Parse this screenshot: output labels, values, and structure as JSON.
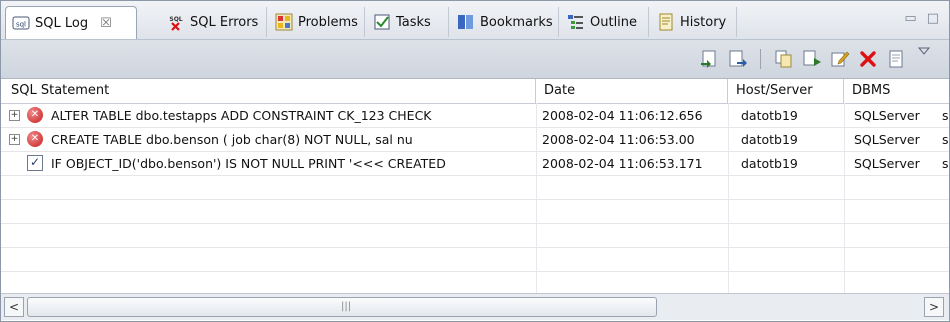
{
  "tabs": [
    {
      "label": "SQL Log",
      "icon": "sql-log-icon",
      "closeable": true
    },
    {
      "label": "SQL Errors",
      "icon": "sql-errors-icon"
    },
    {
      "label": "Problems",
      "icon": "problems-icon"
    },
    {
      "label": "Tasks",
      "icon": "tasks-icon"
    },
    {
      "label": "Bookmarks",
      "icon": "bookmarks-icon"
    },
    {
      "label": "Outline",
      "icon": "outline-icon"
    },
    {
      "label": "History",
      "icon": "history-icon"
    }
  ],
  "tab_close_glyph": "☒",
  "view_controls": {
    "minimize": "▭",
    "maximize": "□"
  },
  "columns": [
    "SQL Statement",
    "Date",
    "Host/Server",
    "DBMS"
  ],
  "rows": [
    {
      "status": "error",
      "expand": "+",
      "statement": "ALTER TABLE dbo.testapps    ADD CONSTRAINT CK_123    CHECK",
      "date": "2008-02-04 11:06:12.656",
      "host": "datotb19",
      "dbms": "SQLServer",
      "extra": "s"
    },
    {
      "status": "error",
      "expand": "+",
      "statement": "CREATE TABLE dbo.benson (    job char(8)       NOT NULL,     sal nu",
      "date": "2008-02-04 11:06:53.00",
      "host": "datotb19",
      "dbms": "SQLServer",
      "extra": "s"
    },
    {
      "status": "success",
      "expand": "",
      "statement": "IF OBJECT_ID('dbo.benson') IS NOT NULL    PRINT '<<< CREATED",
      "date": "2008-02-04 11:06:53.171",
      "host": "datotb19",
      "dbms": "SQLServer",
      "extra": "s"
    }
  ],
  "scrollbar": {
    "left": "<",
    "right": ">",
    "grip": "|||"
  },
  "colors": {
    "error": "#c81e1e",
    "accent": "#2a3c66"
  }
}
